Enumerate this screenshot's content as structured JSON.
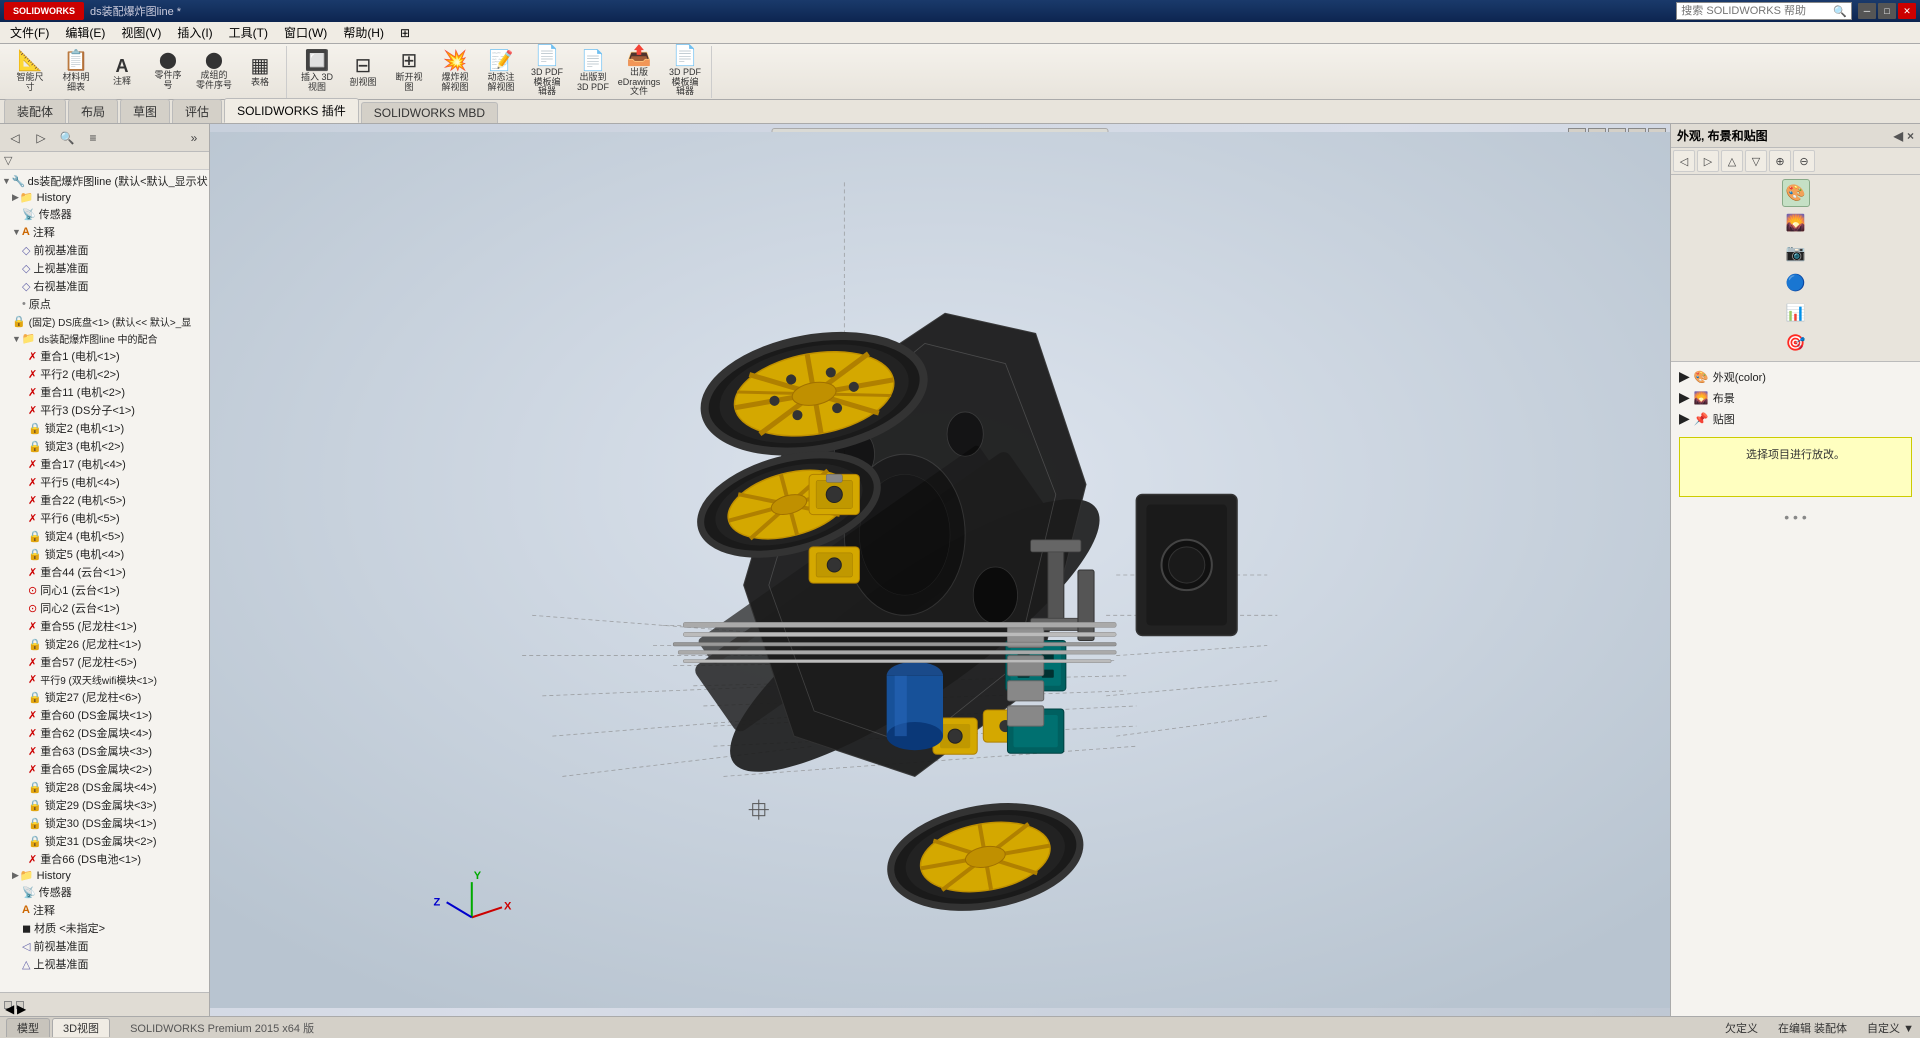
{
  "app": {
    "title": "ds装配爆炸图line *",
    "version": "SOLIDWORKS Premium 2015 x64 版",
    "logo": "SOLIDWORKS"
  },
  "titlebar": {
    "title": "ds装配爆炸图line *",
    "search_placeholder": "搜索 SOLIDWORKS 帮助",
    "controls": [
      "─",
      "□",
      "✕"
    ]
  },
  "menubar": {
    "items": [
      "文件(F)",
      "编辑(E)",
      "视图(V)",
      "插入(I)",
      "工具(T)",
      "窗口(W)",
      "帮助(H)",
      "⊞"
    ]
  },
  "toolbar": {
    "groups": [
      {
        "name": "smart-tools",
        "buttons": [
          {
            "label": "智能尺\n寸",
            "icon": "📐"
          },
          {
            "label": "材料明\n细表",
            "icon": "📋"
          },
          {
            "label": "注释",
            "icon": "A"
          },
          {
            "label": "零件序\n号",
            "icon": "⬤"
          },
          {
            "label": "成组的\n零件序号",
            "icon": "⬤"
          },
          {
            "label": "表格",
            "icon": "▦"
          }
        ]
      },
      {
        "name": "view-tools",
        "buttons": [
          {
            "label": "插入 3D\n视图",
            "icon": "🔲"
          },
          {
            "label": "剖视图",
            "icon": "□"
          },
          {
            "label": "断开视\n开图",
            "icon": "□"
          },
          {
            "label": "爆炸视\n解视图",
            "icon": "💥"
          },
          {
            "label": "动态注\n解视图",
            "icon": "📝"
          },
          {
            "label": "3D PDF\n模板编\n辑器",
            "icon": "📄"
          },
          {
            "label": "出版到\n3D PDF",
            "icon": "📄"
          },
          {
            "label": "出版\neDrawings\n文件",
            "icon": "📤"
          },
          {
            "label": "3D PDF\n模板编\n辑器",
            "icon": "📄"
          }
        ]
      }
    ]
  },
  "tabbar": {
    "tabs": [
      "装配体",
      "布局",
      "草图",
      "评估",
      "SOLIDWORKS 插件",
      "SOLIDWORKS MBD"
    ]
  },
  "leftpanel": {
    "toolbar_buttons": [
      "◀",
      "▶",
      "⊕",
      "☰"
    ],
    "tree_title": "ds装配爆炸图line  (默认<默认_显示状态",
    "tree_items": [
      {
        "level": 1,
        "icon": "📁",
        "label": "History",
        "expandable": true
      },
      {
        "level": 2,
        "icon": "📡",
        "label": "传感器"
      },
      {
        "level": 2,
        "icon": "A",
        "label": "注释",
        "expandable": true
      },
      {
        "level": 3,
        "icon": "◇",
        "label": "前视基准面"
      },
      {
        "level": 3,
        "icon": "◇",
        "label": "上视基准面"
      },
      {
        "level": 3,
        "icon": "◇",
        "label": "右视基准面"
      },
      {
        "level": 3,
        "icon": "•",
        "label": "原点"
      },
      {
        "level": 2,
        "icon": "🔒",
        "label": "(固定) DS底盘<1> (默认<< 默认>_显"
      },
      {
        "level": 2,
        "icon": "📁",
        "label": "ds装配爆炸图line 中的配合",
        "expandable": true
      },
      {
        "level": 3,
        "icon": "✗",
        "label": "重合1 (电机<1>)"
      },
      {
        "level": 3,
        "icon": "✗",
        "label": "平行2 (电机<2>)"
      },
      {
        "level": 3,
        "icon": "✗",
        "label": "重合11 (电机<2>)"
      },
      {
        "level": 3,
        "icon": "✗",
        "label": "平行3 (DS分子<1>)"
      },
      {
        "level": 3,
        "icon": "🔒",
        "label": "锁定2 (电机<1>)"
      },
      {
        "level": 3,
        "icon": "🔒",
        "label": "锁定3 (电机<2>)"
      },
      {
        "level": 3,
        "icon": "✗",
        "label": "重合17 (电机<4>)"
      },
      {
        "level": 3,
        "icon": "✗",
        "label": "平行5 (电机<4>)"
      },
      {
        "level": 3,
        "icon": "✗",
        "label": "重合22 (电机<5>)"
      },
      {
        "level": 3,
        "icon": "✗",
        "label": "平行6 (电机<5>)"
      },
      {
        "level": 3,
        "icon": "🔒",
        "label": "锁定4 (电机<5>)"
      },
      {
        "level": 3,
        "icon": "🔒",
        "label": "锁定5 (电机<4>)"
      },
      {
        "level": 3,
        "icon": "✗",
        "label": "重合44 (云台<1>)"
      },
      {
        "level": 3,
        "icon": "⊙",
        "label": "同心1 (云台<1>)"
      },
      {
        "level": 3,
        "icon": "⊙",
        "label": "同心2 (云台<1>)"
      },
      {
        "level": 3,
        "icon": "✗",
        "label": "重合55 (尼龙柱<1>)"
      },
      {
        "level": 3,
        "icon": "🔒",
        "label": "锁定26 (尼龙柱<1>)"
      },
      {
        "level": 3,
        "icon": "✗",
        "label": "重合57 (尼龙柱<5>)"
      },
      {
        "level": 3,
        "icon": "✗",
        "label": "平行9 (双天线wifi模块<1>)"
      },
      {
        "level": 3,
        "icon": "🔒",
        "label": "锁定27 (尼龙柱<6>)"
      },
      {
        "level": 3,
        "icon": "✗",
        "label": "重合60 (DS金属块<1>)"
      },
      {
        "level": 3,
        "icon": "✗",
        "label": "重合62 (DS金属块<4>)"
      },
      {
        "level": 3,
        "icon": "✗",
        "label": "重合63 (DS金属块<3>)"
      },
      {
        "level": 3,
        "icon": "✗",
        "label": "重合65 (DS金属块<2>)"
      },
      {
        "level": 3,
        "icon": "🔒",
        "label": "锁定28 (DS金属块<4>)"
      },
      {
        "level": 3,
        "icon": "🔒",
        "label": "锁定29 (DS金属块<3>)"
      },
      {
        "level": 3,
        "icon": "🔒",
        "label": "锁定30 (DS金属块<1>)"
      },
      {
        "level": 3,
        "icon": "🔒",
        "label": "锁定31 (DS金属块<2>)"
      },
      {
        "level": 3,
        "icon": "✗",
        "label": "重合66 (DS电池<1>)"
      },
      {
        "level": 1,
        "icon": "📁",
        "label": "History",
        "expandable": true
      },
      {
        "level": 2,
        "icon": "📡",
        "label": "传感器"
      },
      {
        "level": 2,
        "icon": "A",
        "label": "注释"
      },
      {
        "level": 2,
        "icon": "◼",
        "label": "材质 <未指定>"
      },
      {
        "level": 2,
        "icon": "◇",
        "label": "前视基准面"
      },
      {
        "level": 2,
        "icon": "◇",
        "label": "上视基准面"
      }
    ]
  },
  "viewport": {
    "toolbar_buttons": [
      "🔍+",
      "🔍-",
      "🔲",
      "👁",
      "⟳",
      "▦",
      "◉",
      "💡",
      "🔵",
      "📷",
      "⚙"
    ],
    "window_controls": [
      "□",
      "─",
      "□",
      "✕"
    ],
    "compass_label": "XYZ"
  },
  "rightpanel": {
    "title": "外观, 布景和贴图",
    "collapse": "◀",
    "nav_buttons": [
      [
        "◀",
        "▶",
        "⊕",
        "⊕"
      ],
      [
        "⊕",
        "⊕",
        "⊕",
        "⊕"
      ]
    ],
    "side_icons": [
      "👁",
      "🌄",
      "📷",
      "🎨",
      "📊",
      "🎯"
    ],
    "sections": [
      "外观(color)",
      "布景",
      "贴图"
    ],
    "properties_label": "选择项目进行放改。"
  },
  "statusbar": {
    "tabs": [
      "模型",
      "3D视图"
    ],
    "status_items": [
      "欠定义",
      "在编辑 装配体",
      "自定义",
      "▲"
    ],
    "version": "SOLIDWORKS Premium 2015 x64 版"
  }
}
